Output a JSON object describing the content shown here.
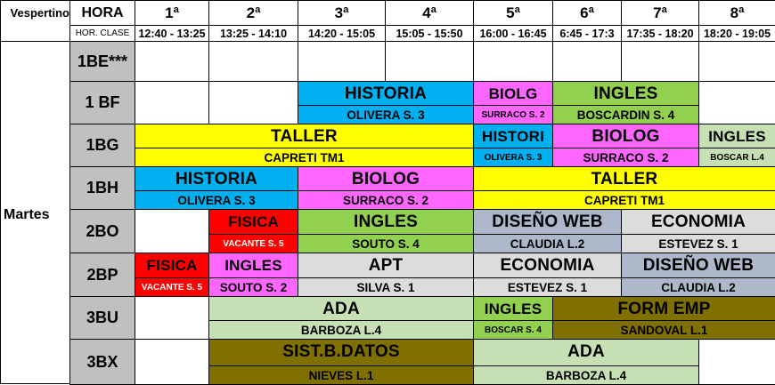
{
  "header": {
    "shift": "Vespertino",
    "hora": "HORA",
    "hor_clase": "HOR. CLASE",
    "day": "Martes",
    "periods": [
      {
        "ord": "1ª",
        "time": "12:40 - 13:25"
      },
      {
        "ord": "2ª",
        "time": "13:25 - 14:10"
      },
      {
        "ord": "3ª",
        "time": "14:20 - 15:05"
      },
      {
        "ord": "4ª",
        "time": "15:05 - 15:50"
      },
      {
        "ord": "5ª",
        "time": "16:00 - 16:45"
      },
      {
        "ord": "6ª",
        "time": "6:45 - 17:3"
      },
      {
        "ord": "7ª",
        "time": "17:35 - 18:20"
      },
      {
        "ord": "8ª",
        "time": "18:20 - 19:05"
      }
    ]
  },
  "colors": {
    "historia": "#00b0f0",
    "biologia": "#ff66ff",
    "ingles": "#92d050",
    "ingles_light": "#c6e0b4",
    "taller": "#ffff00",
    "fisica": "#ff0000",
    "diseno_web": "#adb9ca",
    "economia": "#dcdcdc",
    "apt": "#dcdcdc",
    "ada": "#c6e0b4",
    "form_emp": "#7f7000",
    "sist_datos": "#7f7000",
    "group": "#c0c0c0",
    "empty": "#ffffff"
  },
  "groups": [
    {
      "name": "1BE***",
      "slots": [
        {
          "start": 1,
          "span": 1
        },
        {
          "start": 2,
          "span": 1
        },
        {
          "start": 3,
          "span": 1
        },
        {
          "start": 4,
          "span": 1
        },
        {
          "start": 5,
          "span": 1
        },
        {
          "start": 6,
          "span": 1
        },
        {
          "start": 7,
          "span": 1
        },
        {
          "start": 8,
          "span": 1
        }
      ]
    },
    {
      "name": "1 BF",
      "slots": [
        {
          "start": 1,
          "span": 1
        },
        {
          "start": 2,
          "span": 1
        },
        {
          "start": 3,
          "span": 2,
          "subject": "HISTORIA",
          "teacher": "OLIVERA  S. 3",
          "color": "historia"
        },
        {
          "start": 5,
          "span": 1,
          "subject": "BIOLG",
          "teacher": "SURRACO S. 2",
          "color": "biologia",
          "small": true
        },
        {
          "start": 6,
          "span": 2,
          "subject": "INGLES",
          "teacher": "BOSCARDIN  S. 4",
          "color": "ingles"
        },
        {
          "start": 8,
          "span": 1
        }
      ]
    },
    {
      "name": "1BG",
      "slots": [
        {
          "start": 1,
          "span": 4,
          "subject": "TALLER",
          "teacher": "CAPRETI  TM1",
          "color": "taller"
        },
        {
          "start": 5,
          "span": 1,
          "subject": "HISTORI",
          "teacher": "OLIVERA  S. 3",
          "color": "historia",
          "small": true
        },
        {
          "start": 6,
          "span": 2,
          "subject": "BIOLOG",
          "teacher": "SURRACO  S. 2",
          "color": "biologia"
        },
        {
          "start": 8,
          "span": 1,
          "subject": "INGLES",
          "teacher": "BOSCAR L.4",
          "color": "ingles_light",
          "small": true
        }
      ]
    },
    {
      "name": "1BH",
      "slots": [
        {
          "start": 1,
          "span": 2,
          "subject": "HISTORIA",
          "teacher": "OLIVERA  S. 3",
          "color": "historia"
        },
        {
          "start": 3,
          "span": 2,
          "subject": "BIOLOG",
          "teacher": "SURRACO  S. 2",
          "color": "biologia"
        },
        {
          "start": 5,
          "span": 4,
          "subject": "TALLER",
          "teacher": "CAPRETI  TM1",
          "color": "taller"
        }
      ]
    },
    {
      "name": "2BO",
      "slots": [
        {
          "start": 1,
          "span": 1
        },
        {
          "start": 2,
          "span": 1,
          "subject": "FISICA",
          "teacher": "VACANTE  S. 5",
          "color": "fisica",
          "small": true
        },
        {
          "start": 3,
          "span": 2,
          "subject": "INGLES",
          "teacher": "SOUTO  S. 4",
          "color": "ingles"
        },
        {
          "start": 5,
          "span": 2,
          "subject": "DISEÑO WEB",
          "teacher": "CLAUDIA L.2",
          "color": "diseno_web"
        },
        {
          "start": 7,
          "span": 2,
          "subject": "ECONOMIA",
          "teacher": "ESTEVEZ  S. 1",
          "color": "economia"
        }
      ]
    },
    {
      "name": "2BP",
      "slots": [
        {
          "start": 1,
          "span": 1,
          "subject": "FISICA",
          "teacher": "VACANTE  S. 5",
          "color": "fisica",
          "small": true
        },
        {
          "start": 2,
          "span": 1,
          "subject": "INGLES",
          "teacher": "SOUTO S. 2",
          "color": "biologia"
        },
        {
          "start": 3,
          "span": 2,
          "subject": "APT",
          "teacher": "SILVA  S. 1",
          "color": "apt"
        },
        {
          "start": 5,
          "span": 2,
          "subject": "ECONOMIA",
          "teacher": "ESTEVEZ  S. 1",
          "color": "economia"
        },
        {
          "start": 7,
          "span": 2,
          "subject": "DISEÑO WEB",
          "teacher": "CLAUDIA L.2",
          "color": "diseno_web"
        }
      ]
    },
    {
      "name": "3BU",
      "slots": [
        {
          "start": 1,
          "span": 1
        },
        {
          "start": 2,
          "span": 3,
          "subject": "ADA",
          "teacher": "BARBOZA L.4",
          "color": "ada",
          "light": true
        },
        {
          "start": 5,
          "span": 1,
          "subject": "INGLES",
          "teacher": "BOSCAR  S. 4",
          "color": "ingles",
          "small": true
        },
        {
          "start": 6,
          "span": 3,
          "subject": "FORM EMP",
          "teacher": "SANDOVAL  L.1",
          "color": "form_emp"
        }
      ]
    },
    {
      "name": "3BX",
      "slots": [
        {
          "start": 1,
          "span": 1
        },
        {
          "start": 2,
          "span": 3,
          "subject": "SIST.B.DATOS",
          "teacher": "NIEVES  L.1",
          "color": "sist_datos"
        },
        {
          "start": 5,
          "span": 3,
          "subject": "ADA",
          "teacher": "BARBOZA L.4",
          "color": "ada",
          "light": true
        },
        {
          "start": 8,
          "span": 1
        }
      ]
    }
  ]
}
